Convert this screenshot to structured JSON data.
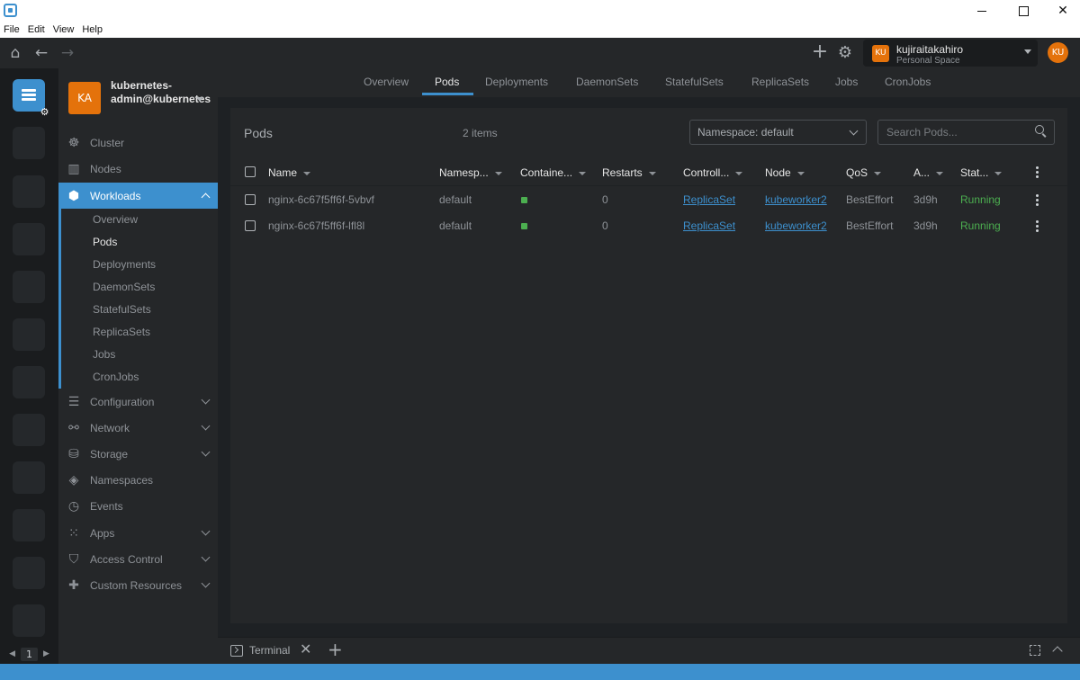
{
  "menu": [
    "File",
    "Edit",
    "View",
    "Help"
  ],
  "topbar": {
    "space_initials": "KU",
    "space_name": "kujiraitakahiro",
    "space_sub": "Personal Space",
    "user_initials": "KU"
  },
  "hotbar": {
    "page": "1"
  },
  "cluster": {
    "initials": "KA",
    "name": "kubernetes-admin@kubernetes"
  },
  "sidebar": {
    "items": [
      {
        "label": "Cluster",
        "icon": "helm-icon"
      },
      {
        "label": "Nodes",
        "icon": "nodes-icon"
      },
      {
        "label": "Workloads",
        "icon": "workloads-icon"
      },
      {
        "label": "Configuration",
        "icon": "list-icon"
      },
      {
        "label": "Network",
        "icon": "network-icon"
      },
      {
        "label": "Storage",
        "icon": "database-icon"
      },
      {
        "label": "Namespaces",
        "icon": "layers-icon"
      },
      {
        "label": "Events",
        "icon": "clock-icon"
      },
      {
        "label": "Apps",
        "icon": "apps-grid-icon"
      },
      {
        "label": "Access Control",
        "icon": "shield-icon"
      },
      {
        "label": "Custom Resources",
        "icon": "puzzle-icon"
      }
    ],
    "workloads_sub": [
      "Overview",
      "Pods",
      "Deployments",
      "DaemonSets",
      "StatefulSets",
      "ReplicaSets",
      "Jobs",
      "CronJobs"
    ]
  },
  "tabs": [
    "Overview",
    "Pods",
    "Deployments",
    "DaemonSets",
    "StatefulSets",
    "ReplicaSets",
    "Jobs",
    "CronJobs"
  ],
  "pods": {
    "title": "Pods",
    "count": "2 items",
    "namespace": "Namespace: default",
    "search_placeholder": "Search Pods...",
    "columns": [
      "Name",
      "Namesp...",
      "Containe...",
      "Restarts",
      "Controll...",
      "Node",
      "QoS",
      "A...",
      "Stat..."
    ],
    "rows": [
      {
        "name": "nginx-6c67f5ff6f-5vbvf",
        "namespace": "default",
        "restarts": "0",
        "controlled_by": "ReplicaSet",
        "node": "kubeworker2",
        "qos": "BestEffort",
        "age": "3d9h",
        "status": "Running"
      },
      {
        "name": "nginx-6c67f5ff6f-lfl8l",
        "namespace": "default",
        "restarts": "0",
        "controlled_by": "ReplicaSet",
        "node": "kubeworker2",
        "qos": "BestEffort",
        "age": "3d9h",
        "status": "Running"
      }
    ]
  },
  "dock": {
    "terminal_label": "Terminal"
  },
  "colors": {
    "accent": "#3d90ce",
    "avatar": "#e4720b",
    "running": "#4caf50"
  }
}
